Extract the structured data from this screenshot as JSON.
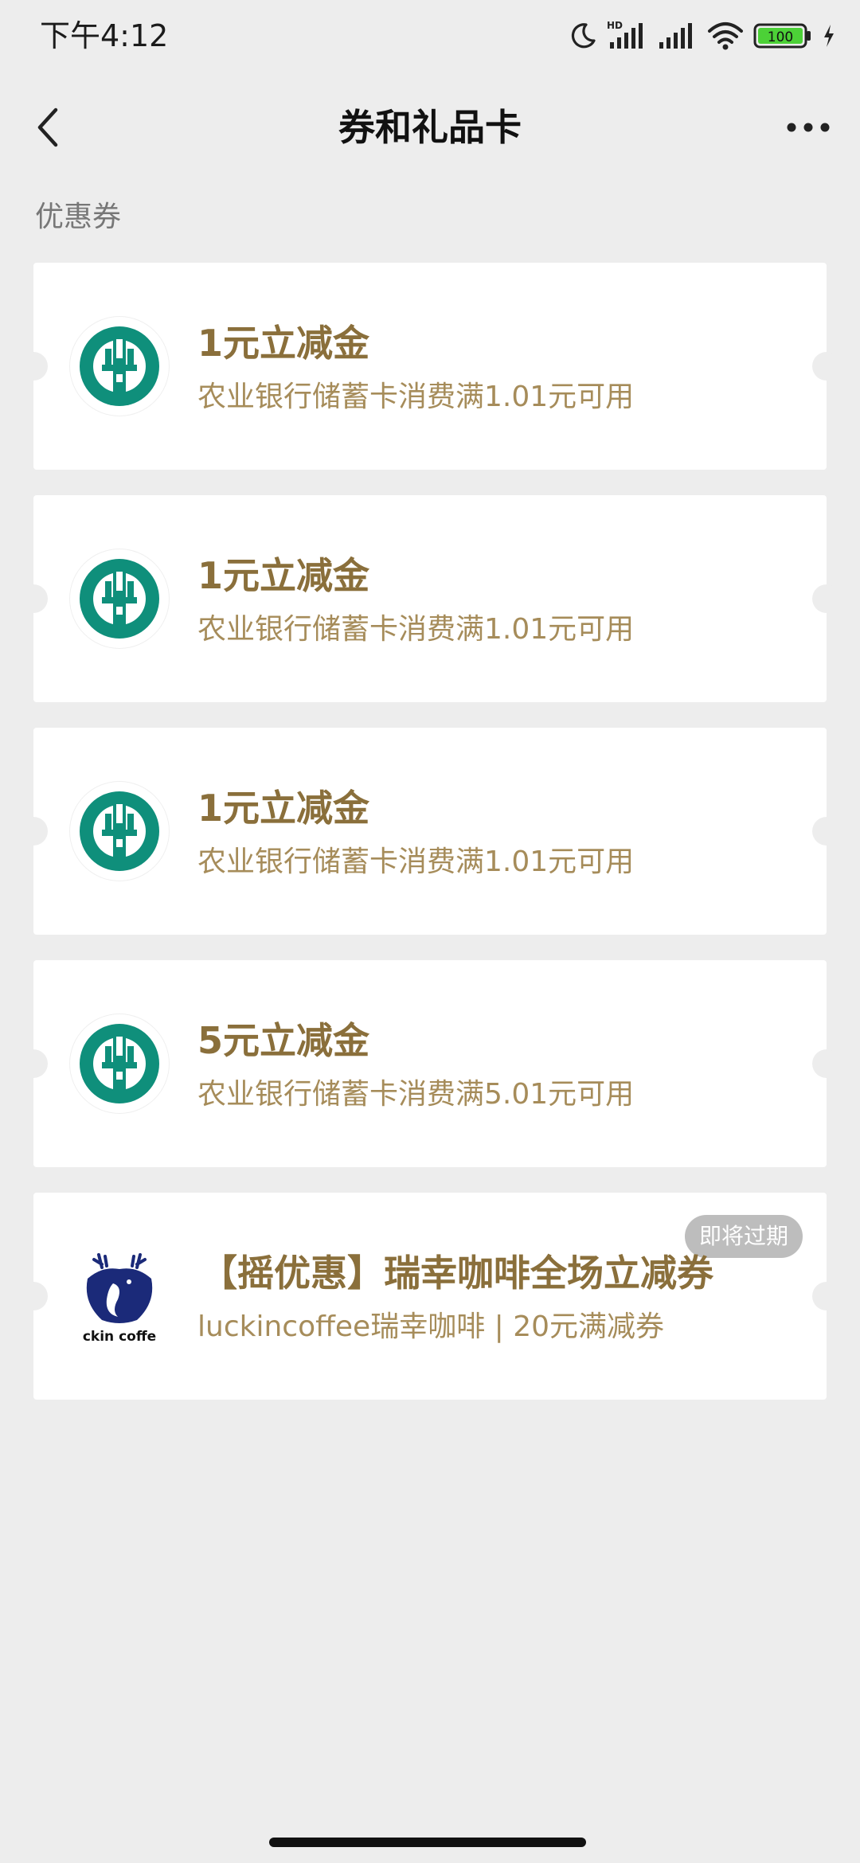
{
  "status_bar": {
    "time": "下午4:12",
    "hd_label": "HD",
    "battery": "100",
    "icons": [
      "moon-icon",
      "signal-hd-icon",
      "signal-icon",
      "wifi-icon",
      "battery-icon",
      "charging-icon"
    ]
  },
  "nav": {
    "title": "券和礼品卡",
    "back_icon": "chevron-left-icon",
    "more_icon": "more-dots-icon"
  },
  "section": {
    "label": "优惠券"
  },
  "coupons": [
    {
      "logo": "abc-bank-logo",
      "title": "1元立减金",
      "desc": "农业银行储蓄卡消费满1.01元可用"
    },
    {
      "logo": "abc-bank-logo",
      "title": "1元立减金",
      "desc": "农业银行储蓄卡消费满1.01元可用"
    },
    {
      "logo": "abc-bank-logo",
      "title": "1元立减金",
      "desc": "农业银行储蓄卡消费满1.01元可用"
    },
    {
      "logo": "abc-bank-logo",
      "title": "5元立减金",
      "desc": "农业银行储蓄卡消费满5.01元可用"
    },
    {
      "logo": "luckin-coffee-logo",
      "logo_text": "ckin coffe",
      "title": "【摇优惠】瑞幸咖啡全场立减券",
      "desc": "luckincoffee瑞幸咖啡 | 20元满减券",
      "badge": "即将过期"
    }
  ],
  "colors": {
    "background": "#ededed",
    "card": "#ffffff",
    "title": "#8a6f3b",
    "desc": "#a68c5a",
    "abc_green": "#0f8f7b",
    "luckin_blue": "#1b2a79",
    "badge": "#bdbdbd"
  }
}
